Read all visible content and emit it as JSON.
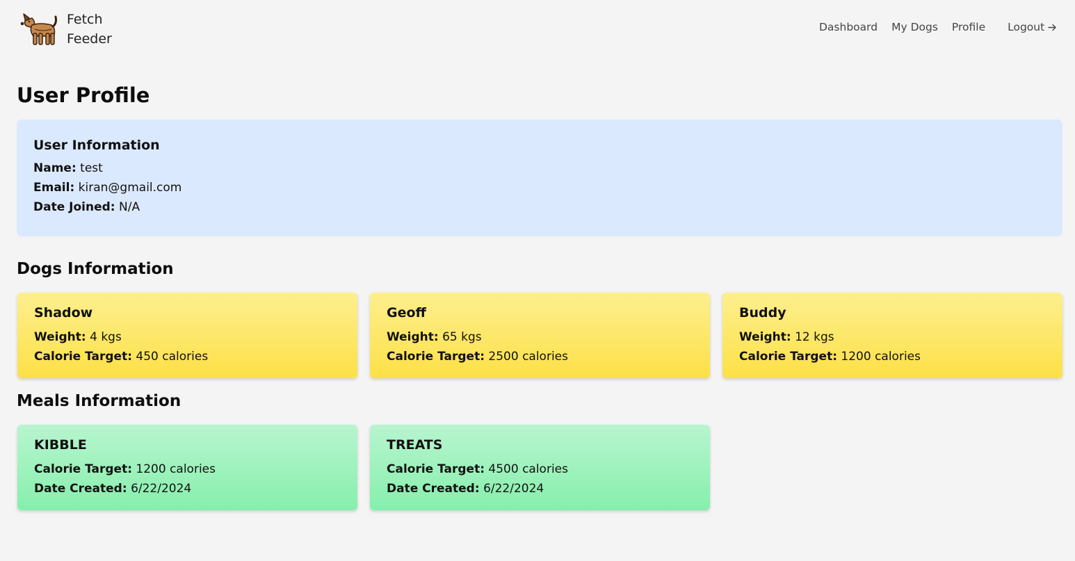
{
  "brand": {
    "line1": "Fetch",
    "line2": "Feeder"
  },
  "nav": {
    "dashboard": "Dashboard",
    "my_dogs": "My Dogs",
    "profile": "Profile",
    "logout": "Logout",
    "logout_icon": "arrow-right-icon"
  },
  "page": {
    "title": "User Profile"
  },
  "user_info": {
    "heading": "User Information",
    "name_label": "Name:",
    "name": "test",
    "email_label": "Email:",
    "email": "kiran@gmail.com",
    "joined_label": "Date Joined:",
    "joined": "N/A"
  },
  "dogs_section": {
    "heading": "Dogs Information",
    "weight_label": "Weight:",
    "calorie_label": "Calorie Target:",
    "dogs": [
      {
        "name": "Shadow",
        "weight": "4 kgs",
        "calories": "450 calories"
      },
      {
        "name": "Geoff",
        "weight": "65 kgs",
        "calories": "2500 calories"
      },
      {
        "name": "Buddy",
        "weight": "12 kgs",
        "calories": "1200 calories"
      }
    ]
  },
  "meals_section": {
    "heading": "Meals Information",
    "calorie_label": "Calorie Target:",
    "date_label": "Date Created:",
    "meals": [
      {
        "name": "KIBBLE",
        "calories": "1200 calories",
        "date": "6/22/2024"
      },
      {
        "name": "TREATS",
        "calories": "4500 calories",
        "date": "6/22/2024"
      }
    ]
  },
  "colors": {
    "background": "#f4f4f4",
    "user_card": "#dbe9fe",
    "dog_card": "#fde047",
    "meal_card": "#86efac"
  }
}
